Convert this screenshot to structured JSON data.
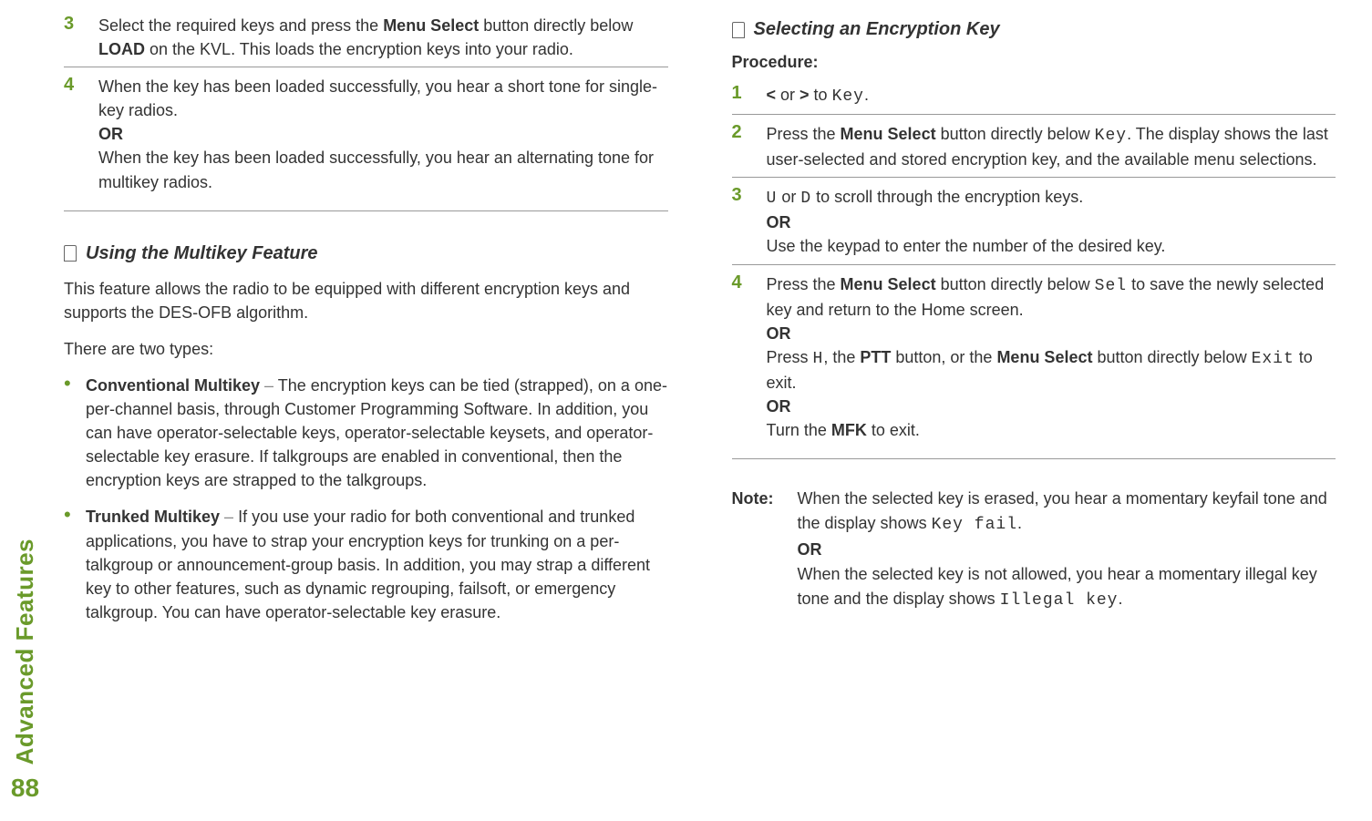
{
  "sidebar": {
    "label": "Advanced Features",
    "page": "88"
  },
  "left": {
    "step3": {
      "num": "3",
      "t1": "Select the required keys and press the ",
      "t2": "Menu Select",
      "t3": " button directly below ",
      "t4": "LOAD",
      "t5": " on the KVL. This loads the encryption keys into your radio."
    },
    "step4": {
      "num": "4",
      "line1": "When the key has been loaded successfully, you hear a short tone for single-key radios.",
      "or": "OR",
      "line2": "When the key has been loaded successfully, you hear an alternating tone for multikey radios."
    },
    "section1": {
      "title": "Using the Multikey Feature"
    },
    "para1": "This feature allows the radio to be equipped with different encryption keys and supports the DES-OFB algorithm.",
    "para2": "There are two types:",
    "b1": {
      "lead": "Conventional Multikey",
      "dash": " – ",
      "text": "The encryption keys can be tied (strapped), on a one-per-channel basis, through Customer Programming Software. In addition, you can have operator-selectable keys, operator-selectable keysets, and operator-selectable key erasure. If talkgroups are enabled in conventional, then the encryption keys are strapped to the talkgroups."
    },
    "b2": {
      "lead": "Trunked Multikey",
      "dash": " – ",
      "text": "If you use your radio for both conventional and trunked applications, you have to strap your encryption keys for trunking on a per-talkgroup or announcement-group basis. In addition, you may strap a different key to other features, such as dynamic regrouping, failsoft, or emergency talkgroup. You can have operator-selectable key erasure."
    }
  },
  "right": {
    "section": {
      "title": "Selecting an Encryption Key"
    },
    "proc": "Procedure:",
    "s1": {
      "num": "1",
      "a": "<",
      "b": " or ",
      "c": ">",
      "d": " to ",
      "e": "Key",
      "f": "."
    },
    "s2": {
      "num": "2",
      "t1": "Press the ",
      "t2": "Menu Select",
      "t3": " button directly below ",
      "t4": "Key",
      "t5": ". The display shows the last user-selected and stored encryption key, and the available menu selections."
    },
    "s3": {
      "num": "3",
      "a": "U",
      "b": " or ",
      "c": "D",
      "d": " to scroll through the encryption keys.",
      "or": "OR",
      "line2": "Use the keypad to enter the number of the desired key."
    },
    "s4": {
      "num": "4",
      "t1": "Press the ",
      "t2": "Menu Select",
      "t3": " button directly below ",
      "t4": "Sel",
      "t5": " to save the newly selected key and return to the Home screen.",
      "or1": "OR",
      "p2a": "Press ",
      "p2b": "H",
      "p2c": ", the ",
      "p2d": "PTT",
      "p2e": " button, or the ",
      "p2f": "Menu Select",
      "p2g": " button directly below ",
      "p2h": "Exit",
      "p2i": " to exit.",
      "or2": "OR",
      "p3a": "Turn the ",
      "p3b": "MFK",
      "p3c": " to exit."
    },
    "note": {
      "label": "Note:",
      "l1a": "When the selected key is erased, you hear a momentary keyfail tone and the display shows ",
      "l1b": "Key fail",
      "l1c": ".",
      "or": "OR",
      "l2a": "When the selected key is not allowed, you hear a momentary illegal key tone and the display shows ",
      "l2b": "Illegal key",
      "l2c": "."
    }
  }
}
